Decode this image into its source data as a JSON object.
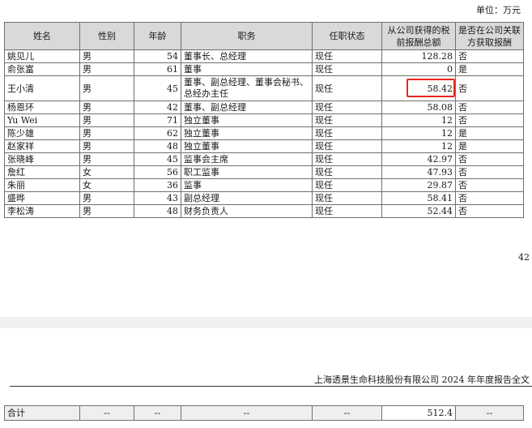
{
  "unit_label": "单位：万元",
  "table": {
    "headers": [
      "姓名",
      "性别",
      "年龄",
      "职务",
      "任职状态",
      "从公司获得的税前报酬总额",
      "是否在公司关联方获取报酬"
    ],
    "rows": [
      {
        "name": "姚见儿",
        "gender": "男",
        "age": "54",
        "position": "董事长、总经理",
        "status": "现任",
        "pay": "128.28",
        "related": "否"
      },
      {
        "name": "俞张富",
        "gender": "男",
        "age": "61",
        "position": "董事",
        "status": "现任",
        "pay": "0",
        "related": "是"
      },
      {
        "name": "王小清",
        "gender": "男",
        "age": "45",
        "position": "董事、副总经理、董事会秘书、总经办主任",
        "status": "现任",
        "pay": "58.42",
        "related": "否"
      },
      {
        "name": "杨恩环",
        "gender": "男",
        "age": "42",
        "position": "董事、副总经理",
        "status": "现任",
        "pay": "58.08",
        "related": "否"
      },
      {
        "name": "Yu Wei",
        "gender": "男",
        "age": "71",
        "position": "独立董事",
        "status": "现任",
        "pay": "12",
        "related": "否"
      },
      {
        "name": "陈少雄",
        "gender": "男",
        "age": "62",
        "position": "独立董事",
        "status": "现任",
        "pay": "12",
        "related": "是"
      },
      {
        "name": "赵家祥",
        "gender": "男",
        "age": "48",
        "position": "独立董事",
        "status": "现任",
        "pay": "12",
        "related": "是"
      },
      {
        "name": "张晓峰",
        "gender": "男",
        "age": "45",
        "position": "监事会主席",
        "status": "现任",
        "pay": "42.97",
        "related": "否"
      },
      {
        "name": "詹红",
        "gender": "女",
        "age": "56",
        "position": "职工监事",
        "status": "现任",
        "pay": "47.93",
        "related": "否"
      },
      {
        "name": "朱丽",
        "gender": "女",
        "age": "36",
        "position": "监事",
        "status": "现任",
        "pay": "29.87",
        "related": "否"
      },
      {
        "name": "盛晔",
        "gender": "男",
        "age": "43",
        "position": "副总经理",
        "status": "现任",
        "pay": "58.41",
        "related": "否"
      },
      {
        "name": "李松涛",
        "gender": "男",
        "age": "48",
        "position": "财务负责人",
        "status": "现任",
        "pay": "52.44",
        "related": "否"
      }
    ]
  },
  "page_number": "42",
  "footer_text": "上海透景生命科技股份有限公司 2024 年年度报告全文",
  "total_row": {
    "label": "合计",
    "gender": "--",
    "age": "--",
    "position": "--",
    "status": "--",
    "pay": "512.4",
    "related": "--"
  },
  "highlight_color": "#e8271c"
}
